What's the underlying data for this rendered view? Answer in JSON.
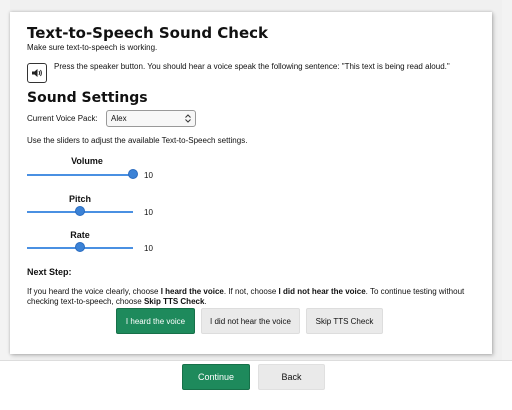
{
  "title": "Text-to-Speech Sound Check",
  "intro": "Make sure text-to-speech is working.",
  "speaker_instruction": "Press the speaker button. You should hear a voice speak the following sentence: \"This text is being read aloud.\"",
  "settings_heading": "Sound Settings",
  "voice_pack_label": "Current Voice Pack:",
  "voice_pack_value": "Alex",
  "sliders_info": "Use the sliders to adjust the available Text-to-Speech settings.",
  "sliders": [
    {
      "label": "Volume",
      "value": "10",
      "fraction": 1.0
    },
    {
      "label": "Pitch",
      "value": "10",
      "fraction": 0.5
    },
    {
      "label": "Rate",
      "value": "10",
      "fraction": 0.5
    }
  ],
  "next_step_heading": "Next Step:",
  "instructions": {
    "p1": "If you heard the voice clearly, choose ",
    "b1": "I heard the voice",
    "p2": ". If not, choose ",
    "b2": "I did not hear the voice",
    "p3": ". To continue testing without checking text-to-speech, choose ",
    "b3": "Skip TTS Check",
    "p4": "."
  },
  "buttons": {
    "heard": "I heard the voice",
    "not_heard": "I did not hear the voice",
    "skip": "Skip TTS Check",
    "continue": "Continue",
    "back": "Back"
  },
  "colors": {
    "primary": "#1e8a5c",
    "slider": "#3b82d6"
  },
  "icons": {
    "speaker": "speaker-icon",
    "select_arrows": "chevron-updown-icon"
  }
}
